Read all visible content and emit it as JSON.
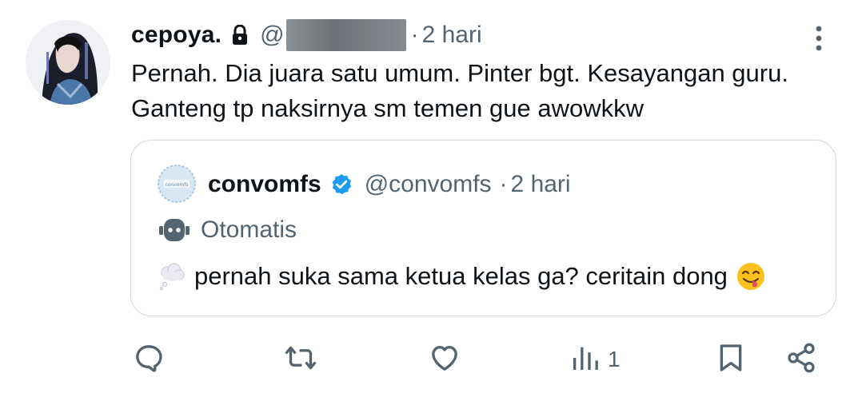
{
  "tweet": {
    "display_name": "cepoya.",
    "handle_prefix": "@",
    "separator": "·",
    "time": "2 hari",
    "text_lines": [
      "Pernah. Dia juara satu umum. Pinter bgt. Kesayangan guru.",
      "Ganteng tp naksirnya sm temen gue awowkkw"
    ]
  },
  "quote": {
    "display_name": "convomfs",
    "handle": "@convomfs",
    "separator": "·",
    "time": "2 hari",
    "automated_label": "Otomatis",
    "text": "pernah suka sama ketua kelas ga? ceritain dong",
    "avatar_logo_text": "convomfs"
  },
  "actions": {
    "views_count": "1"
  },
  "icons": {
    "lock": "lock-icon",
    "more": "more-vertical-icon",
    "verified": "verified-badge-icon",
    "robot": "robot-icon",
    "thought_bubble": "thought-bubble-emoji",
    "yum": "face-savoring-food-emoji",
    "reply": "reply-icon",
    "retweet": "retweet-icon",
    "like": "heart-icon",
    "views": "views-chart-icon",
    "bookmark": "bookmark-icon",
    "share": "share-icon"
  },
  "colors": {
    "text_primary": "#0f1419",
    "text_secondary": "#536471",
    "border": "#cfd9de",
    "verified_blue": "#1d9bf0"
  }
}
